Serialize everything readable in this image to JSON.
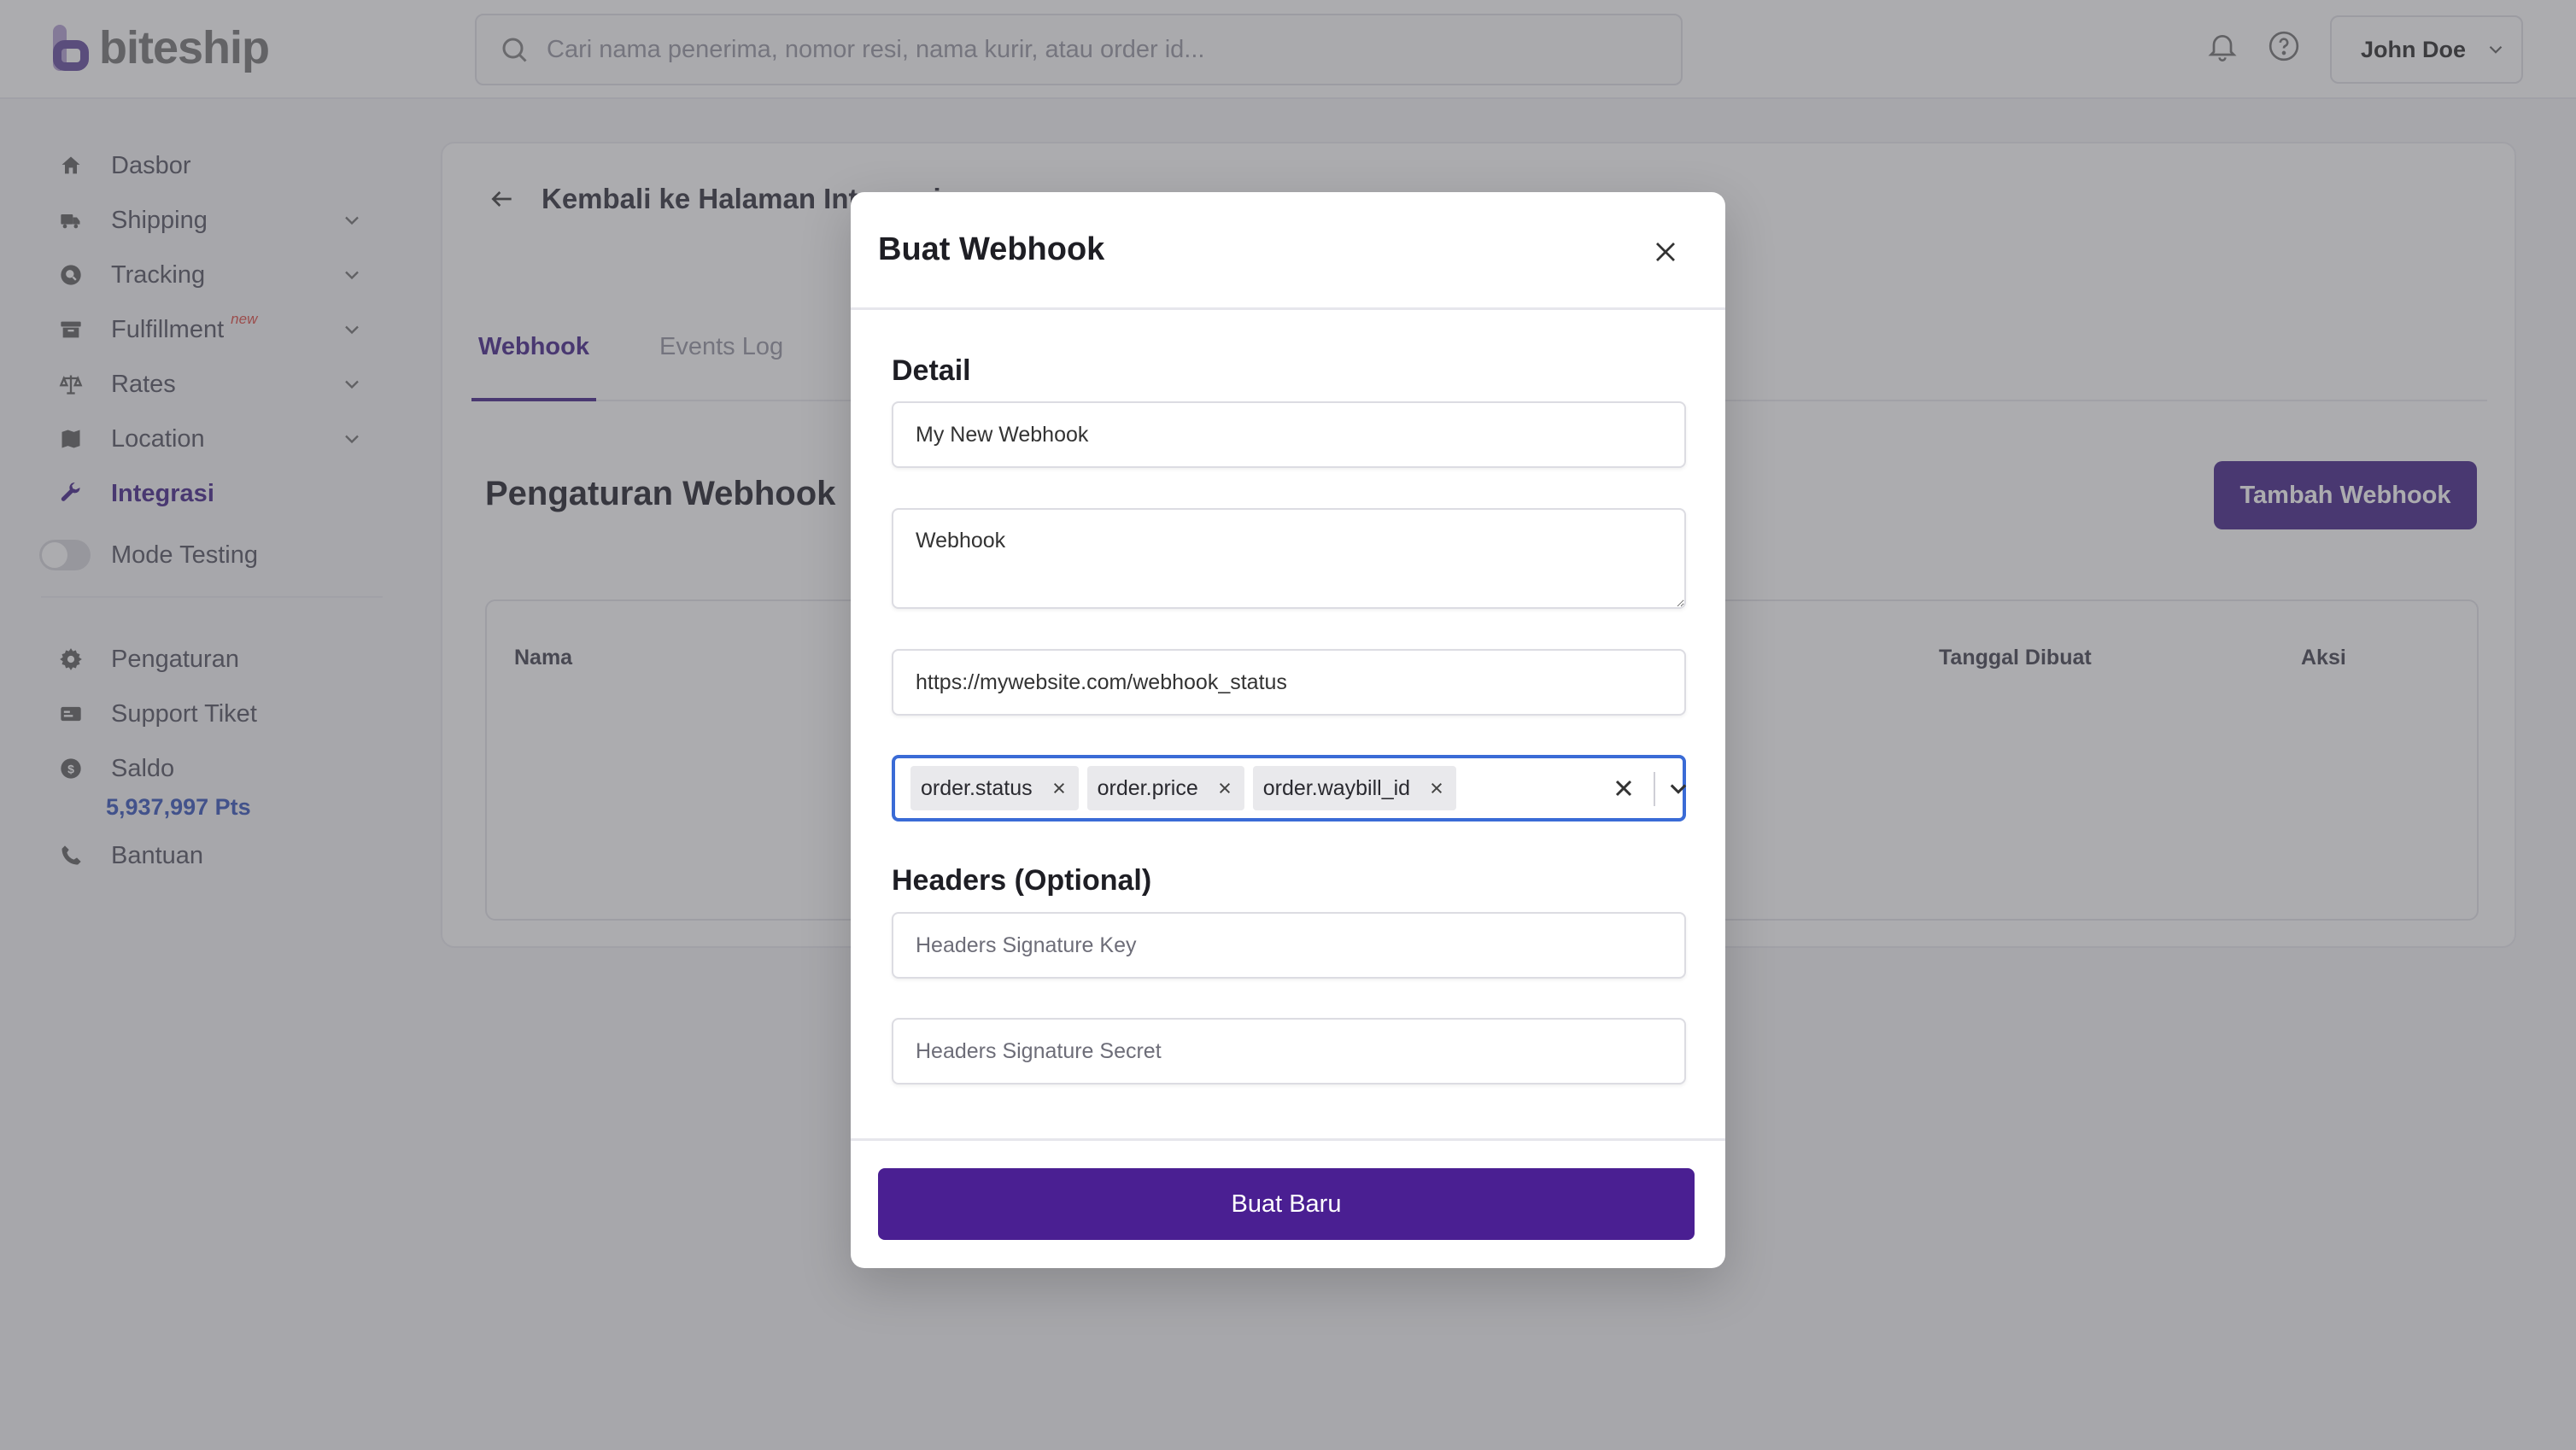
{
  "app": {
    "logo_text": "biteship",
    "search_placeholder": "Cari nama penerima, nomor resi, nama kurir, atau order id...",
    "user_name": "John Doe",
    "brand_color": "#4b2c8f"
  },
  "sidebar": {
    "items": [
      {
        "label": "Dasbor",
        "icon": "home-icon"
      },
      {
        "label": "Shipping",
        "icon": "truck-icon"
      },
      {
        "label": "Tracking",
        "icon": "tracking-icon"
      },
      {
        "label": "Fulfillment",
        "icon": "box-icon",
        "badge": "new"
      },
      {
        "label": "Rates",
        "icon": "scale-icon"
      },
      {
        "label": "Location",
        "icon": "map-icon"
      },
      {
        "label": "Integrasi",
        "icon": "wrench-icon"
      },
      {
        "label": "Mode Testing",
        "icon": "toggle"
      },
      {
        "label": "Pengaturan",
        "icon": "gear-icon"
      },
      {
        "label": "Support Tiket",
        "icon": "ticket-icon"
      },
      {
        "label": "Saldo",
        "icon": "coin-icon"
      },
      {
        "label": "Bantuan",
        "icon": "phone-icon"
      }
    ],
    "points": "5,937,997 Pts"
  },
  "main": {
    "back_label": "Kembali ke Halaman Integrasi",
    "tabs": [
      "Webhook",
      "Events Log"
    ],
    "section_title": "Pengaturan Webhook",
    "add_button": "Tambah Webhook",
    "table_headers": [
      "Nama",
      "Tanggal Dibuat",
      "Aksi"
    ]
  },
  "modal": {
    "title": "Buat Webhook",
    "detail_title": "Detail",
    "name_value": "My New Webhook",
    "description_value": "Webhook",
    "url_value": "https://mywebsite.com/webhook_status",
    "events": [
      "order.status",
      "order.price",
      "order.waybill_id"
    ],
    "headers_title": "Headers (Optional)",
    "signature_key_placeholder": "Headers Signature Key",
    "signature_secret_placeholder": "Headers Signature Secret",
    "submit_label": "Buat Baru"
  }
}
